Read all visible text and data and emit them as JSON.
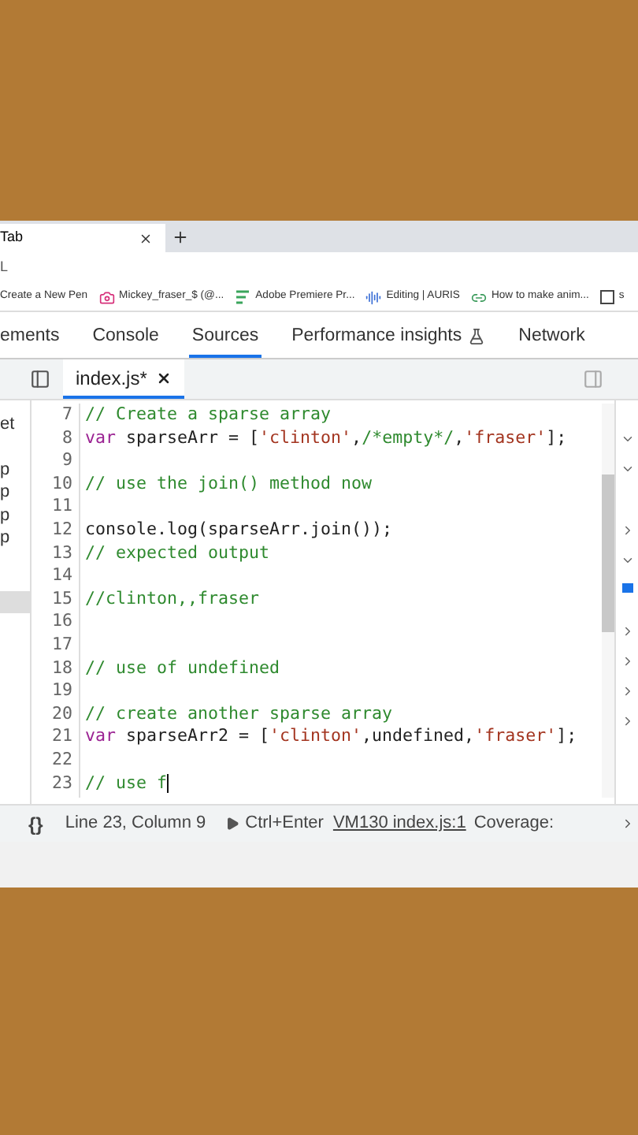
{
  "browser": {
    "tabs": [
      {
        "title": "Tab",
        "selected": true
      }
    ],
    "address": "L",
    "bookmarks": [
      {
        "kind": "plain",
        "label": "Create a New Pen"
      },
      {
        "kind": "camera",
        "label": "Mickey_fraser_$ (@..."
      },
      {
        "kind": "lines",
        "label": "Adobe Premiere Pr..."
      },
      {
        "kind": "wave",
        "label": "Editing | AURIS"
      },
      {
        "kind": "link",
        "label": "How to make anim..."
      },
      {
        "kind": "box",
        "label": "s"
      }
    ]
  },
  "devtools": {
    "tabs": [
      {
        "label": "ements",
        "selected": false,
        "experimental": false
      },
      {
        "label": "Console",
        "selected": false,
        "experimental": false
      },
      {
        "label": "Sources",
        "selected": true,
        "experimental": false
      },
      {
        "label": "Performance insights",
        "selected": false,
        "experimental": true
      },
      {
        "label": "Network",
        "selected": false,
        "experimental": false
      }
    ],
    "file_tab": {
      "name": "index.js*",
      "selected": true
    },
    "navigator": [
      "et",
      "p",
      "p",
      "p",
      "p"
    ],
    "lines": [
      {
        "number": "7",
        "cursor": false,
        "tokens": [
          {
            "kind": "comment",
            "text": "// Create a sparse array"
          }
        ]
      },
      {
        "number": "8",
        "cursor": false,
        "tokens": [
          {
            "kind": "keyword",
            "text": "var"
          },
          {
            "kind": "plain",
            "text": " sparseArr = ["
          },
          {
            "kind": "string",
            "text": "'clinton'"
          },
          {
            "kind": "plain",
            "text": ","
          },
          {
            "kind": "comment",
            "text": "/*empty*/"
          },
          {
            "kind": "plain",
            "text": ","
          },
          {
            "kind": "string",
            "text": "'fraser'"
          },
          {
            "kind": "plain",
            "text": "];"
          }
        ]
      },
      {
        "number": "9",
        "cursor": false
      },
      {
        "number": "10",
        "cursor": false,
        "tokens": [
          {
            "kind": "comment",
            "text": "// use the join() method now"
          }
        ]
      },
      {
        "number": "11",
        "cursor": false
      },
      {
        "number": "12",
        "cursor": false,
        "tokens": [
          {
            "kind": "plain",
            "text": "console.log(sparseArr.join());"
          }
        ]
      },
      {
        "number": "13",
        "cursor": false,
        "tokens": [
          {
            "kind": "comment",
            "text": "// expected output"
          }
        ]
      },
      {
        "number": "14",
        "cursor": false
      },
      {
        "number": "15",
        "cursor": false,
        "tokens": [
          {
            "kind": "comment",
            "text": "//clinton,,fraser"
          }
        ]
      },
      {
        "number": "16",
        "cursor": false
      },
      {
        "number": "17",
        "cursor": false
      },
      {
        "number": "18",
        "cursor": false,
        "tokens": [
          {
            "kind": "comment",
            "text": "// use of undefined"
          }
        ]
      },
      {
        "number": "19",
        "cursor": false
      },
      {
        "number": "20",
        "cursor": false,
        "tokens": [
          {
            "kind": "comment",
            "text": "// create another sparse array"
          }
        ]
      },
      {
        "number": "21",
        "cursor": false,
        "tokens": [
          {
            "kind": "keyword",
            "text": "var"
          },
          {
            "kind": "plain",
            "text": " sparseArr2 = ["
          },
          {
            "kind": "string",
            "text": "'clinton'"
          },
          {
            "kind": "plain",
            "text": ",undefined,"
          },
          {
            "kind": "string",
            "text": "'fraser'"
          },
          {
            "kind": "plain",
            "text": "];"
          }
        ]
      },
      {
        "number": "22",
        "cursor": false
      },
      {
        "number": "23",
        "cursor": true,
        "tokens": [
          {
            "kind": "comment",
            "text": "// use f"
          }
        ]
      }
    ],
    "status": {
      "format": "{}",
      "position": "Line 23, Column 9",
      "run": "Ctrl+Enter",
      "source_link": "VM130 index.js:1",
      "coverage": "Coverage:"
    }
  }
}
